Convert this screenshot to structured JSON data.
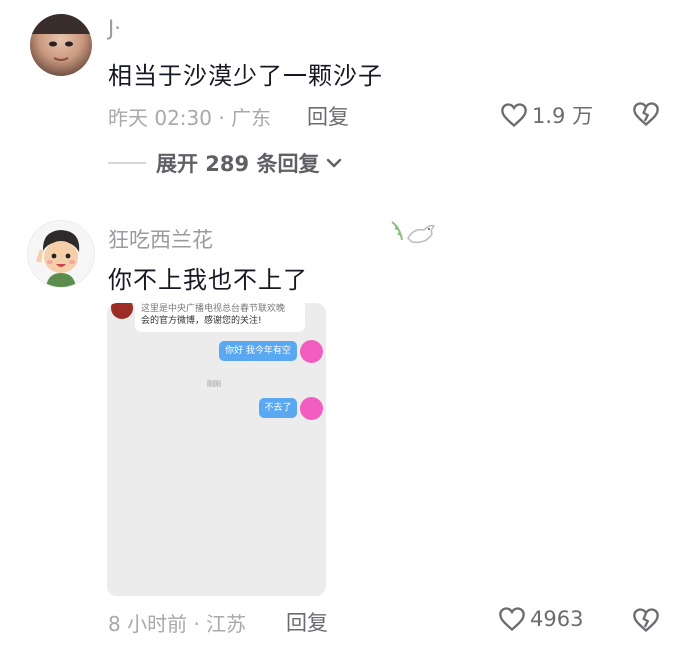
{
  "comments": [
    {
      "username": "J·",
      "text": "相当于沙漠少了一颗沙子",
      "meta": "昨天 02:30 · 广东",
      "reply_label": "回复",
      "likes": "1.9 万",
      "expand_label": "展开 289 条回复"
    },
    {
      "username": "狂吃西兰花",
      "text": "你不上我也不上了",
      "meta": "8 小时前 · 江苏",
      "reply_label": "回复",
      "likes": "4963",
      "attachment": {
        "notice_line1": "这里是中央广播电视总台春节联欢晚",
        "notice_line2": "会的官方微博，感谢您的关注!",
        "msg1": "你好 我今年有空",
        "time": "刚刚",
        "msg2": "不去了"
      }
    }
  ],
  "colors": {
    "accent_blue": "#5aa8f2",
    "pink": "#f25ec0",
    "muted": "#a8a9ad"
  },
  "icons": [
    "heart-icon",
    "broken-heart-icon",
    "chevron-down-icon",
    "dove-badge-icon"
  ]
}
